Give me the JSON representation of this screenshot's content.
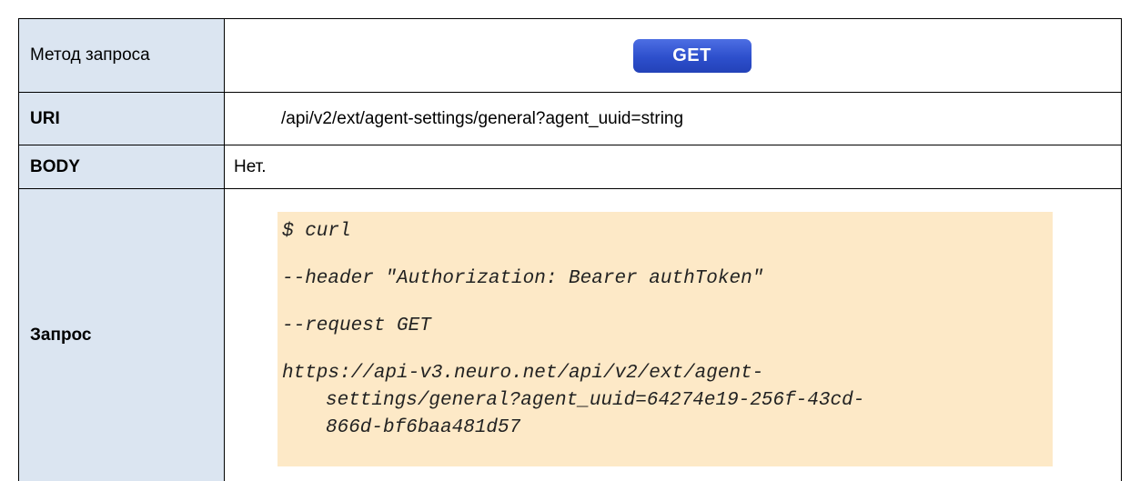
{
  "rows": {
    "method": {
      "label": "Метод запроса",
      "value": "GET"
    },
    "uri": {
      "label": "URI",
      "value": "/api/v2/ext/agent-settings/general?agent_uuid=string"
    },
    "body": {
      "label": "BODY",
      "value": "Нет."
    },
    "request": {
      "label": "Запрос",
      "code_lines": [
        "$ curl",
        "--header \"Authorization: Bearer authToken\"",
        "--request GET"
      ],
      "url_lines": [
        "https://api-v3.neuro.net/api/v2/ext/agent-",
        "settings/general?agent_uuid=64274e19-256f-43cd-",
        "866d-bf6baa481d57"
      ]
    }
  },
  "colors": {
    "label_bg": "#dbe5f1",
    "badge_bg": "#2d4fcc",
    "code_bg": "#fde9c7"
  }
}
